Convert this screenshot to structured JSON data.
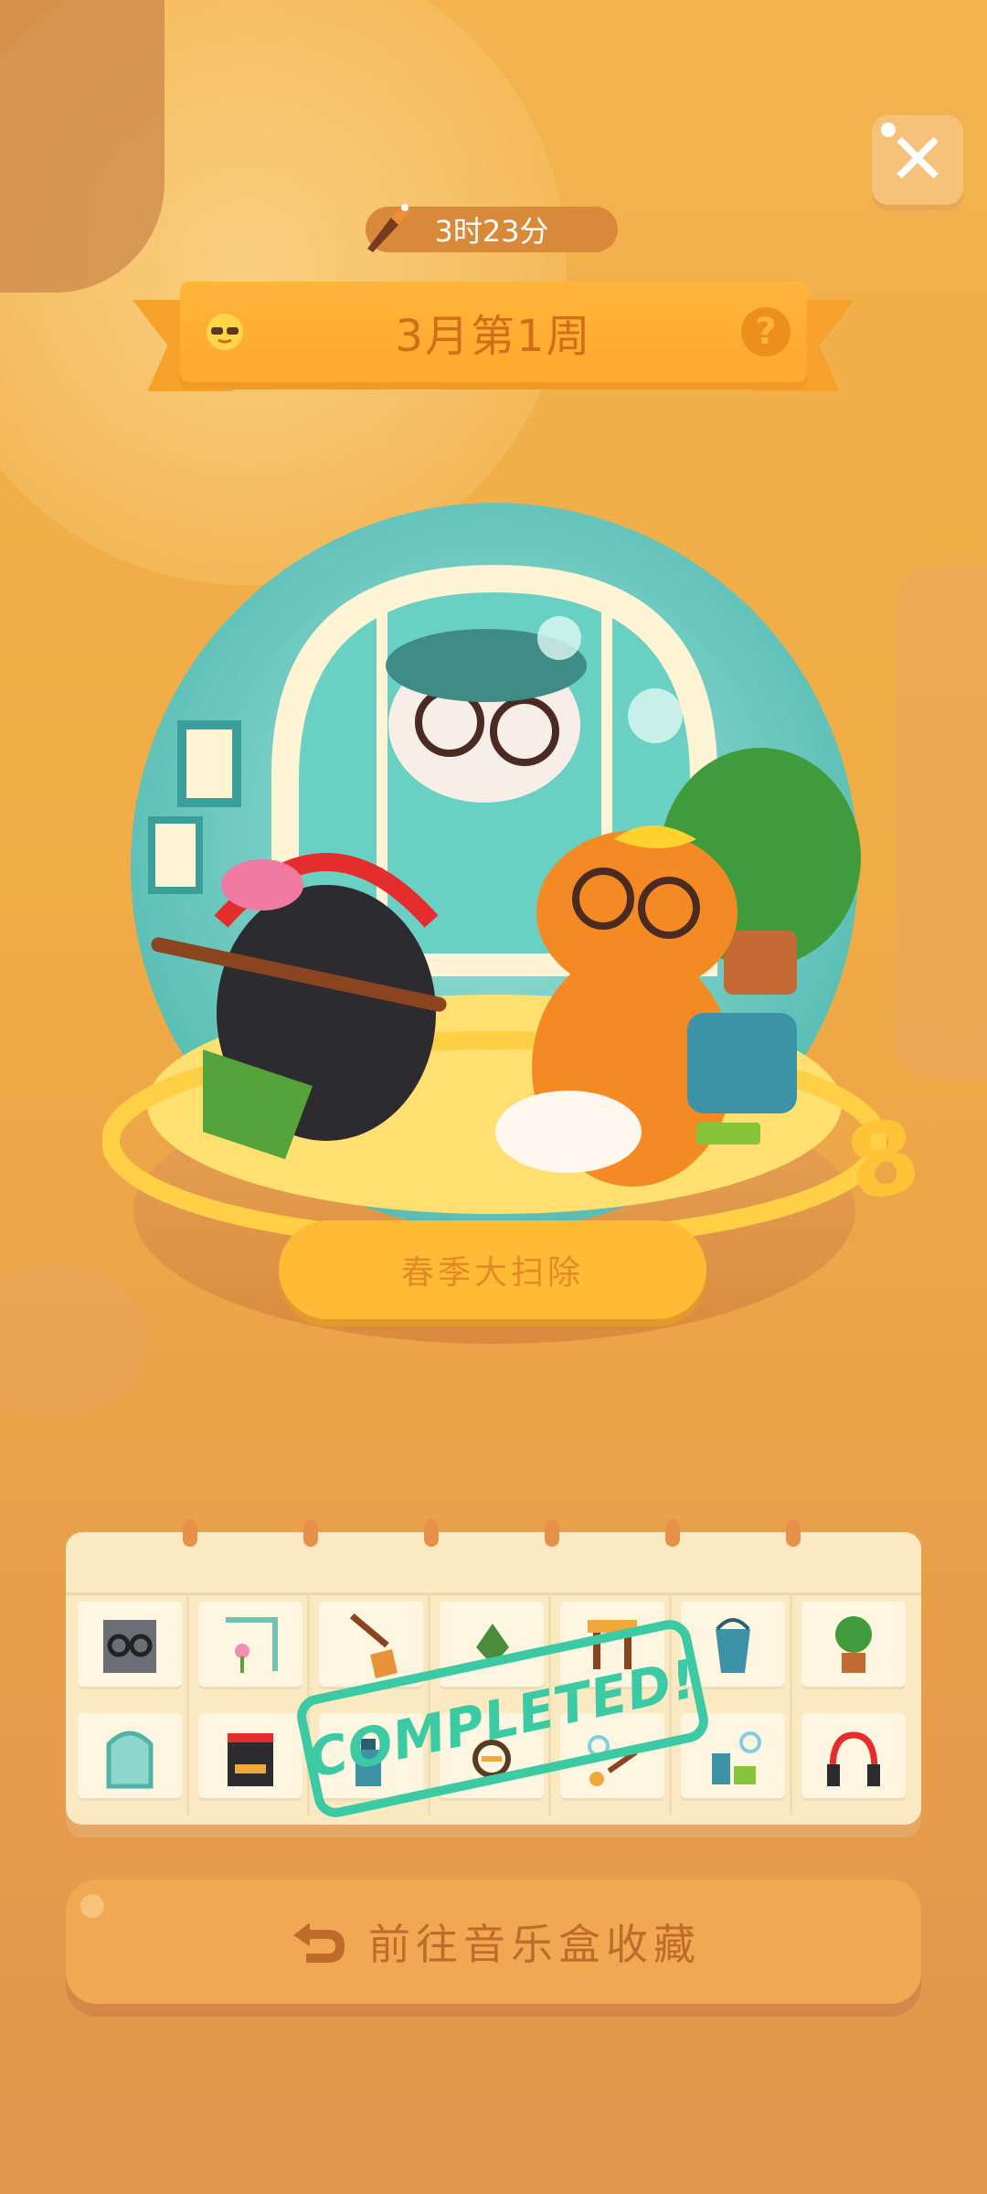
{
  "header": {
    "timer_text": "3时23分",
    "week_title": "3月第1周",
    "help_label": "?",
    "close_label": "✕"
  },
  "scene": {
    "plate_text": "春季大扫除",
    "side_number": "8"
  },
  "calendar": {
    "stamp_text": "COMPLETED!",
    "items": [
      "glasses-cat-icon",
      "flower-frame-icon",
      "broom-icon",
      "plant-sprout-icon",
      "stool-icon",
      "bucket-icon",
      "potted-plant-icon",
      "window-icon",
      "black-cat-icon",
      "spray-icon",
      "dustpan-icon",
      "bubbles-icon",
      "cleaner-bottles-icon",
      "headphones-icon"
    ]
  },
  "cta": {
    "label": "前往音乐盒收藏"
  },
  "colors": {
    "accent": "#ffb53a",
    "stamp": "#3ccaa4",
    "cta": "#f0a853"
  }
}
